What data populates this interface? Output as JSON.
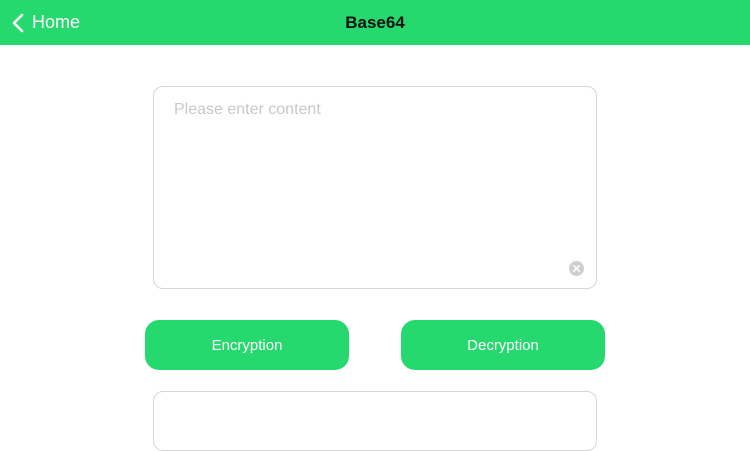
{
  "header": {
    "back_label": "Home",
    "title": "Base64",
    "back_icon": "chevron-left-icon",
    "background_color": "#26d96e"
  },
  "input": {
    "value": "",
    "placeholder": "Please enter content",
    "clear_icon": "clear-circle-icon"
  },
  "actions": {
    "encrypt_label": "Encryption",
    "decrypt_label": "Decryption",
    "button_color": "#26d96e"
  },
  "output": {
    "value": ""
  }
}
